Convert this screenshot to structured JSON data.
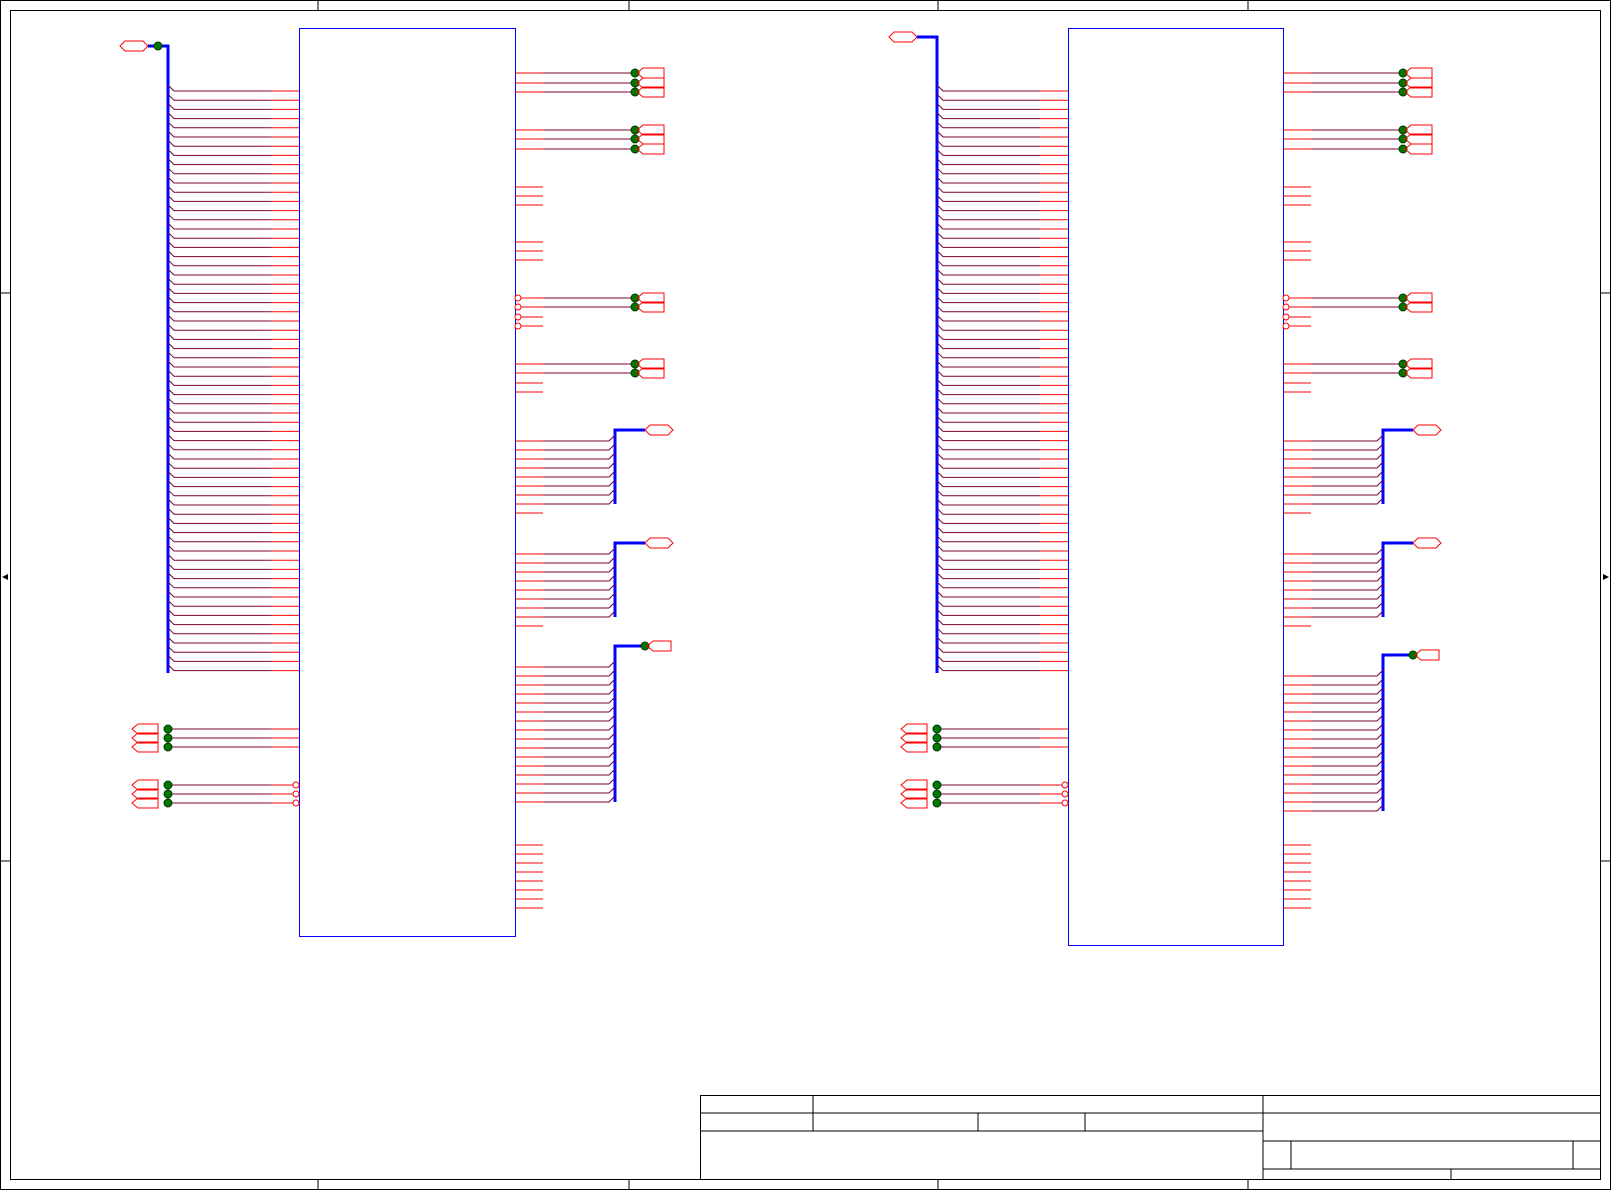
{
  "sheet": {
    "border_color": "#000000",
    "title_block_color": "#000000"
  },
  "colors": {
    "component_outline": "#0000ff",
    "bus": "#0000ff",
    "pin": "#ff0000",
    "wire": "#7a0033",
    "junction_fill": "#007700",
    "junction_stroke": "#003300",
    "port": "#ff0000",
    "background": "#ffffff"
  },
  "components": [
    {
      "ref": "",
      "value": ""
    },
    {
      "ref": "",
      "value": ""
    }
  ],
  "title_block": {
    "title": "",
    "document_number": "",
    "revision": "",
    "size": "",
    "date": "",
    "sheet": ""
  }
}
